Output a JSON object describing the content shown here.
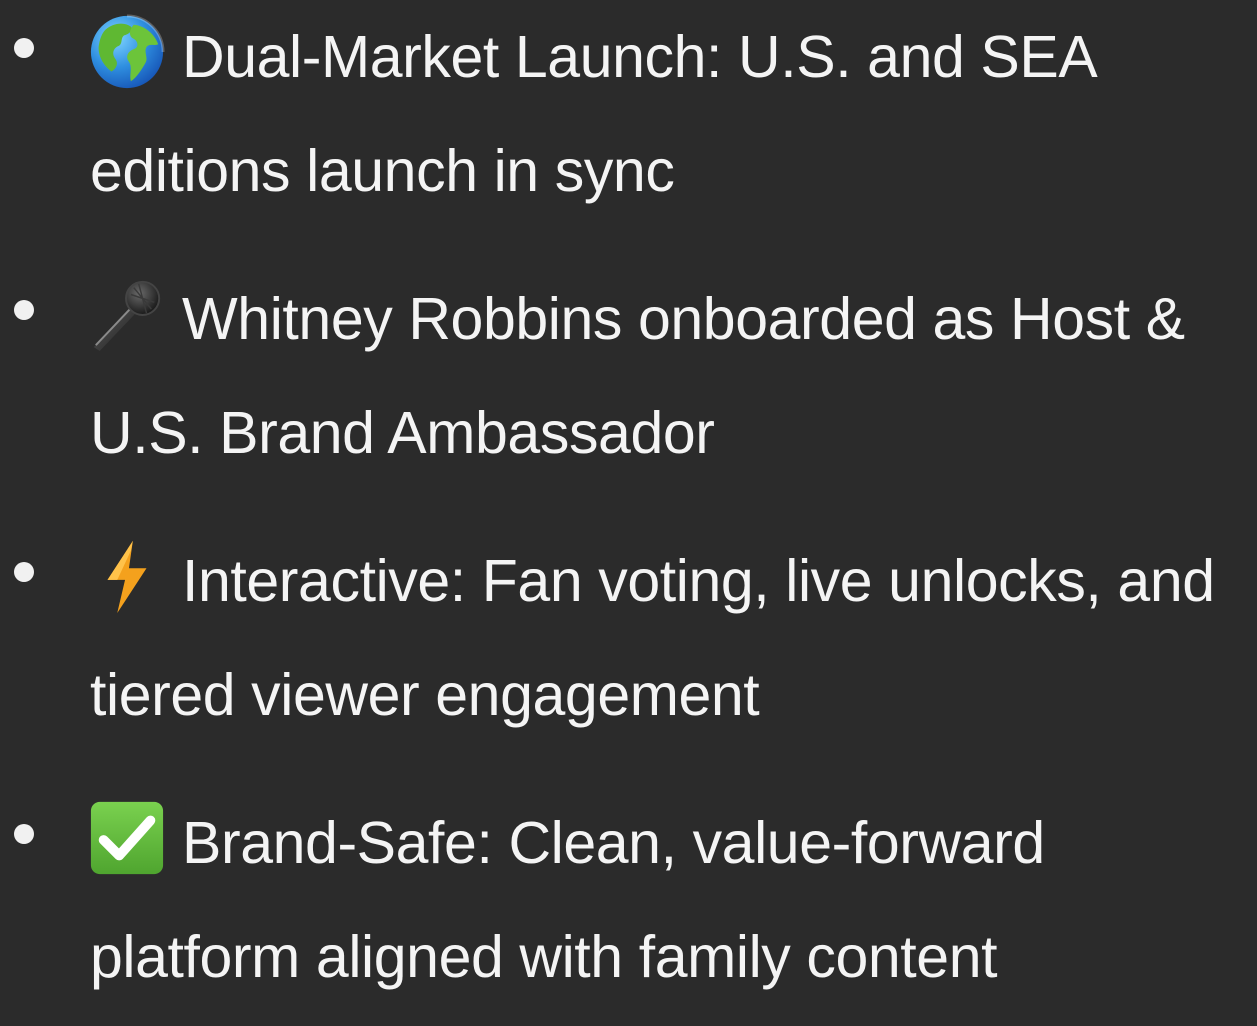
{
  "bullets": [
    {
      "icon": "globe-icon",
      "text": "Dual-Market Launch: U.S. and SEA editions launch in sync"
    },
    {
      "icon": "microphone-icon",
      "text": "Whitney Robbins onboarded as Host & U.S. Brand Ambassador"
    },
    {
      "icon": "lightning-icon",
      "text": "Interactive: Fan voting, live unlocks, and tiered viewer engagement"
    },
    {
      "icon": "check-mark-icon",
      "text": "Brand-Safe: Clean, value-forward platform aligned with family content"
    }
  ],
  "colors": {
    "background": "#2b2b2b",
    "text": "#f4f4f4",
    "check_green": "#6cc04a",
    "bolt_orange": "#f4a11d"
  }
}
